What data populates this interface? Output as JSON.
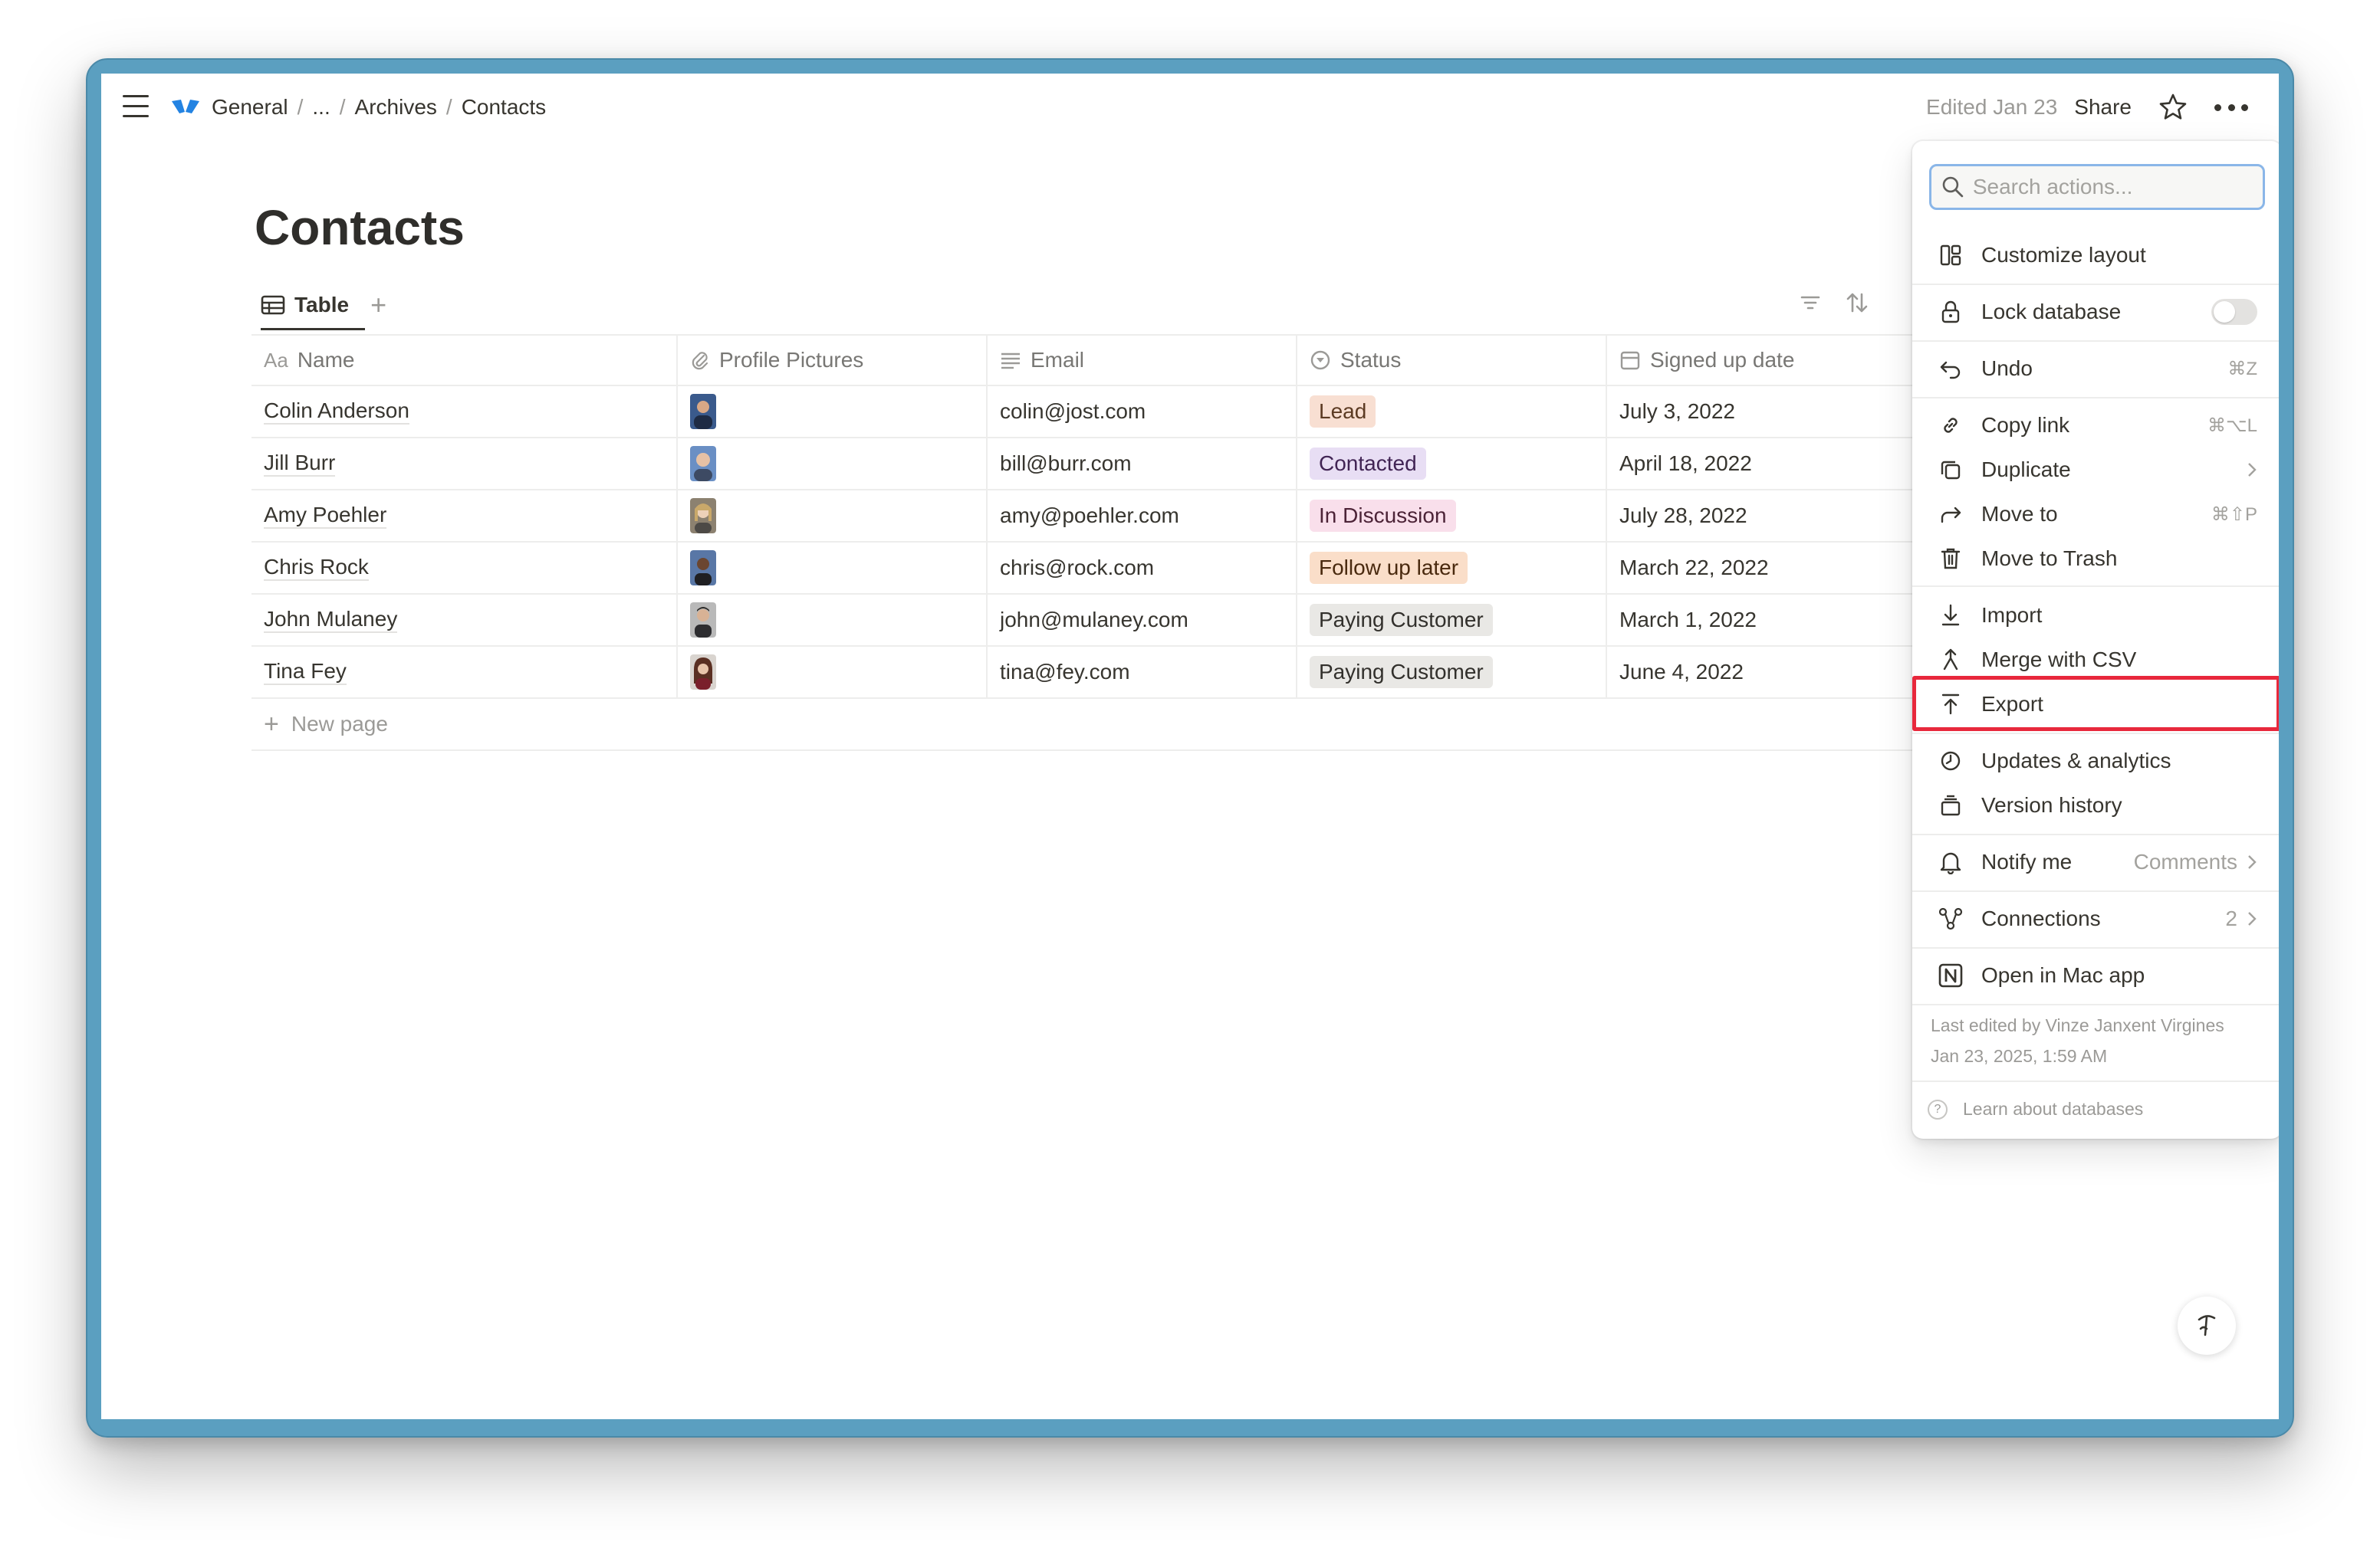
{
  "topbar": {
    "breadcrumbs": [
      "General",
      "...",
      "Archives",
      "Contacts"
    ],
    "edited": "Edited Jan 23",
    "share_label": "Share"
  },
  "page": {
    "title": "Contacts",
    "view_tab": "Table",
    "add_view": "+"
  },
  "table": {
    "columns": [
      "Name",
      "Profile Pictures",
      "Email",
      "Status",
      "Signed up date"
    ],
    "name_prefix": "Aa",
    "rows": [
      {
        "name": "Colin Anderson",
        "email": "colin@jost.com",
        "status": "Lead",
        "date": "July 3, 2022"
      },
      {
        "name": "Jill Burr",
        "email": "bill@burr.com",
        "status": "Contacted",
        "date": "April 18, 2022"
      },
      {
        "name": "Amy Poehler",
        "email": "amy@poehler.com",
        "status": "In Discussion",
        "date": "July 28, 2022"
      },
      {
        "name": "Chris Rock",
        "email": "chris@rock.com",
        "status": "Follow up later",
        "date": "March 22, 2022"
      },
      {
        "name": "John Mulaney",
        "email": "john@mulaney.com",
        "status": "Paying Customer",
        "date": "March 1, 2022"
      },
      {
        "name": "Tina Fey",
        "email": "tina@fey.com",
        "status": "Paying Customer",
        "date": "June 4, 2022"
      }
    ],
    "new_page": "New page"
  },
  "status_colors": {
    "Lead": {
      "bg": "#f8dfd2",
      "fg": "#5c3b23"
    },
    "Contacted": {
      "bg": "#e8def4",
      "fg": "#412454"
    },
    "In Discussion": {
      "bg": "#f9dfeb",
      "fg": "#4c2337"
    },
    "Follow up later": {
      "bg": "#fadec9",
      "fg": "#49290e"
    },
    "Paying Customer": {
      "bg": "#e9e8e5",
      "fg": "#32302c"
    }
  },
  "menu": {
    "search_placeholder": "Search actions...",
    "items": {
      "customize_layout": "Customize layout",
      "lock_database": "Lock database",
      "undo": "Undo",
      "undo_shortcut": "⌘Z",
      "copy_link": "Copy link",
      "copy_link_shortcut": "⌘⌥L",
      "duplicate": "Duplicate",
      "move_to": "Move to",
      "move_to_shortcut": "⌘⇧P",
      "move_to_trash": "Move to Trash",
      "import": "Import",
      "merge_csv": "Merge with CSV",
      "export": "Export",
      "updates": "Updates & analytics",
      "version_history": "Version history",
      "notify_me": "Notify me",
      "notify_value": "Comments",
      "connections": "Connections",
      "connections_count": "2",
      "open_mac": "Open in Mac app"
    },
    "last_edited_line1": "Last edited by Vinze Janxent Virgines",
    "last_edited_line2": "Jan 23, 2025, 1:59 AM",
    "learn": "Learn about databases"
  },
  "icons": [
    "hamburger-icon",
    "workspace-logo-icon",
    "star-icon",
    "more-icon",
    "table-icon",
    "filter-icon",
    "sort-icon",
    "search-icon",
    "help-icon"
  ],
  "colors": {
    "highlight": "#e8283c",
    "frame": "#5b9fc0",
    "search_border": "#8ab6e8"
  }
}
